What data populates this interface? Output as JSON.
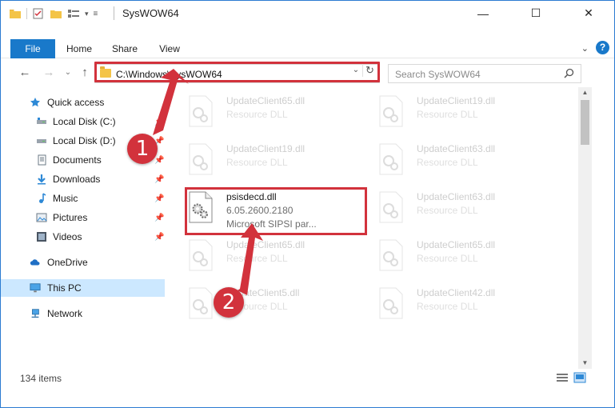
{
  "window": {
    "title": "SysWOW64",
    "controls": {
      "minimize": "—",
      "maximize": "☐",
      "close": "✕"
    }
  },
  "ribbon": {
    "tabs": [
      {
        "label": "File",
        "active": true
      },
      {
        "label": "Home"
      },
      {
        "label": "Share"
      },
      {
        "label": "View"
      }
    ],
    "help_label": "?"
  },
  "navigation": {
    "back_icon": "←",
    "forward_icon": "→",
    "recent_icon": "⌄",
    "up_icon": "↑",
    "address": "C:\\Windows\\SysWOW64",
    "search_placeholder": "Search SysWOW64"
  },
  "sidebar": {
    "items": [
      {
        "label": "Quick access",
        "icon": "star-icon",
        "pinned": false
      },
      {
        "label": "Local Disk (C:)",
        "icon": "drive-icon",
        "pinned": true
      },
      {
        "label": "Local Disk (D:)",
        "icon": "drive-icon",
        "pinned": true
      },
      {
        "label": "Documents",
        "icon": "documents-icon",
        "pinned": true
      },
      {
        "label": "Downloads",
        "icon": "download-icon",
        "pinned": true
      },
      {
        "label": "Music",
        "icon": "music-icon",
        "pinned": true
      },
      {
        "label": "Pictures",
        "icon": "pictures-icon",
        "pinned": true
      },
      {
        "label": "Videos",
        "icon": "videos-icon",
        "pinned": true
      },
      {
        "label": "OneDrive",
        "icon": "cloud-icon",
        "pinned": false
      },
      {
        "label": "This PC",
        "icon": "computer-icon",
        "pinned": false,
        "selected": true
      },
      {
        "label": "Network",
        "icon": "network-icon",
        "pinned": false
      }
    ]
  },
  "files": [
    {
      "name": "UpdateClient65.dll",
      "type": "Resource DLL",
      "faded": true
    },
    {
      "name": "UpdateClient19.dll",
      "type": "Resource DLL",
      "faded": true
    },
    {
      "name": "UpdateClient19.dll",
      "type": "Resource DLL",
      "faded": true
    },
    {
      "name": "UpdateClient63.dll",
      "type": "Resource DLL",
      "faded": true
    },
    {
      "name": "psisdecd.dll",
      "type": "6.05.2600.2180",
      "extra": "Microsoft SIPSI par...",
      "faded": false
    },
    {
      "name": "UpdateClient63.dll",
      "type": "Resource DLL",
      "faded": true
    },
    {
      "name": "UpdateClient65.dll",
      "type": "Resource DLL",
      "faded": true
    },
    {
      "name": "UpdateClient65.dll",
      "type": "Resource DLL",
      "faded": true
    },
    {
      "name": "UpdateClient5.dll",
      "type": "Resource DLL",
      "faded": true
    },
    {
      "name": "UpdateClient42.dll",
      "type": "Resource DLL",
      "faded": true
    }
  ],
  "status": {
    "item_count": "134 items"
  },
  "callouts": {
    "one": "1",
    "two": "2"
  },
  "colors": {
    "accent": "#1979ca",
    "highlight": "#d2323c",
    "selected": "#cce8ff"
  }
}
